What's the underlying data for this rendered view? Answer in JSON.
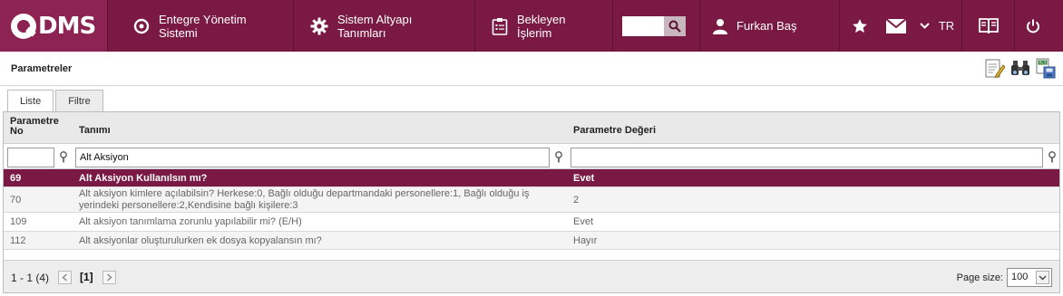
{
  "brand": {
    "logo_text": "DMS"
  },
  "nav": {
    "items": [
      {
        "label": "Entegre Yönetim Sistemi"
      },
      {
        "label": "Sistem Altyapı Tanımları"
      },
      {
        "label": "Bekleyen İşlerim"
      }
    ]
  },
  "search": {
    "value": "",
    "placeholder": ""
  },
  "user": {
    "name": "Furkan Baş"
  },
  "language": {
    "code": "TR"
  },
  "page": {
    "title": "Parametreler"
  },
  "tabs": [
    {
      "label": "Liste",
      "active": true
    },
    {
      "label": "Filtre",
      "active": false
    }
  ],
  "grid": {
    "columns": {
      "no": "Parametre No",
      "tanim": "Tanımı",
      "deger": "Parametre Değeri"
    },
    "filters": {
      "no": "",
      "tanim": "Alt Aksiyon",
      "deger": ""
    },
    "rows": [
      {
        "no": "69",
        "tanim": "Alt Aksiyon Kullanılsın mı?",
        "deger": "Evet",
        "selected": true
      },
      {
        "no": "70",
        "tanim": "Alt aksiyon kimlere açılabilsin? Herkese:0, Bağlı olduğu departmandaki personellere:1, Bağlı olduğu iş yerindeki personellere:2,Kendisine bağlı kişilere:3",
        "deger": "2",
        "selected": false
      },
      {
        "no": "109",
        "tanim": "Alt aksiyon tanımlama zorunlu yapılabilir mi? (E/H)",
        "deger": "Evet",
        "selected": false
      },
      {
        "no": "112",
        "tanim": "Alt aksiyonlar oluşturulurken ek dosya kopyalansın mı?",
        "deger": "Hayır",
        "selected": false
      }
    ]
  },
  "pager": {
    "info": "1 - 1 (4)",
    "current_page": "[1]",
    "page_size_label": "Page size:",
    "page_size": "100"
  },
  "colors": {
    "brand": "#7a1a44",
    "brand_light": "#8d2352",
    "selected_row": "#7a1a44"
  }
}
